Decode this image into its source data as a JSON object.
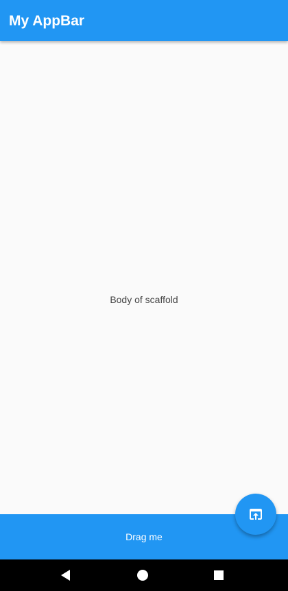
{
  "appbar": {
    "title": "My AppBar",
    "color": "#2196F3"
  },
  "body": {
    "text": "Body of scaffold",
    "background": "#FAFAFA"
  },
  "bottom_sheet": {
    "label": "Drag me",
    "color": "#2196F3"
  },
  "fab": {
    "icon": "open-in-browser-icon",
    "color": "#2196F3"
  },
  "system_nav": {
    "buttons": [
      {
        "icon": "back-triangle-icon"
      },
      {
        "icon": "home-circle-icon"
      },
      {
        "icon": "recents-square-icon"
      }
    ],
    "color": "#000000"
  }
}
